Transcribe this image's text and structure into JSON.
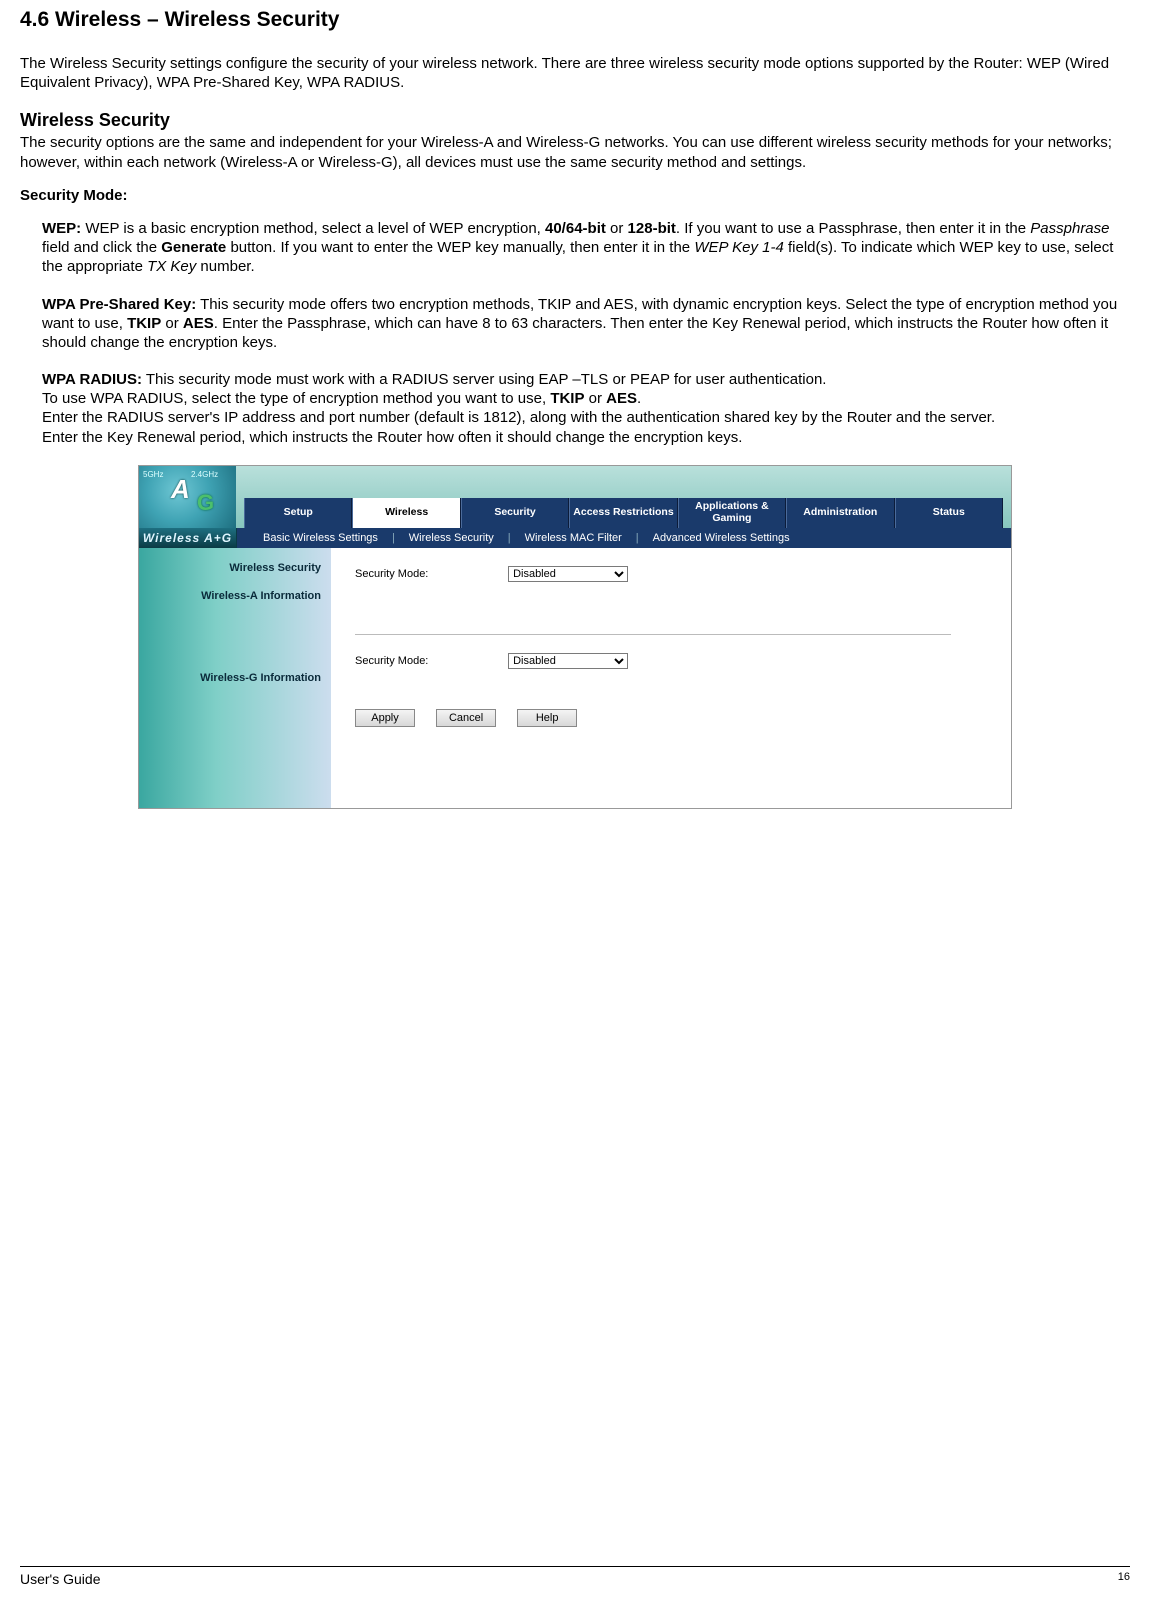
{
  "section_title": "4.6 Wireless – Wireless Security",
  "intro": "The Wireless Security settings configure the security of your wireless network. There are three wireless security mode options supported by the Router: WEP (Wired Equivalent Privacy), WPA Pre-Shared Key, WPA RADIUS.",
  "h_wireless_security": "Wireless Security",
  "ws_desc": "The security options are the same and independent for your Wireless-A and Wireless-G networks. You can use different wireless security methods for your networks; however, within each network (Wireless-A or Wireless-G), all devices must use the same security method and settings.",
  "h_security_mode": "Security Mode:",
  "wep_label": "WEP:",
  "wep_text_1": " WEP is a basic encryption method, select a level of WEP encryption, ",
  "wep_bold1": "40/64-bit",
  "wep_or": " or ",
  "wep_bold2": "128-bit",
  "wep_text_2": ". If you want to use a Passphrase, then enter it in the ",
  "wep_italic1": "Passphrase",
  "wep_text_3": " field and click the ",
  "wep_bold3": "Generate",
  "wep_text_4": " button. If you want to enter the WEP key manually, then enter it in the ",
  "wep_italic2": "WEP Key 1-4",
  "wep_text_5": " field(s). To indicate which WEP key to use, select the appropriate ",
  "wep_italic3": "TX Key",
  "wep_text_6": " number.",
  "wpa_psk_label": "WPA Pre-Shared Key:",
  "wpa_psk_text_1": " This security mode offers two encryption methods, TKIP and AES, with dynamic encryption keys. Select the type of encryption method you want to use, ",
  "wpa_psk_bold1": "TKIP",
  "wpa_psk_or": " or ",
  "wpa_psk_bold2": "AES",
  "wpa_psk_text_2": ". Enter the Passphrase, which can have 8 to 63 characters. Then enter the Key Renewal period, which instructs the Router how often it should change the encryption keys.",
  "wpa_rad_label": "WPA RADIUS:",
  "wpa_rad_text_1": " This security mode must work with a RADIUS server using EAP –TLS or PEAP for user authentication.",
  "wpa_rad_text_2a": "To use WPA RADIUS, select the type of encryption method you want to use, ",
  "wpa_rad_bold1": "TKIP",
  "wpa_rad_or": " or ",
  "wpa_rad_bold2": "AES",
  "wpa_rad_text_2b": ".",
  "wpa_rad_text_3": "Enter the RADIUS server's IP address and port number (default is 1812), along with the authentication shared key by the Router and the server.",
  "wpa_rad_text_4": "Enter the Key Renewal period, which instructs the Router how often it should change the encryption keys.",
  "router": {
    "logo_5": "5GHz",
    "logo_24": "2.4GHz",
    "logo_a": "A",
    "logo_g": "G",
    "brand": "Wireless A+G",
    "tabs": [
      "Setup",
      "Wireless",
      "Security",
      "Access Restrictions",
      "Applications & Gaming",
      "Administration",
      "Status"
    ],
    "subtabs": [
      "Basic Wireless Settings",
      "Wireless Security",
      "Wireless MAC Filter",
      "Advanced Wireless Settings"
    ],
    "side": [
      "Wireless Security",
      "Wireless-A Information",
      "Wireless-G Information"
    ],
    "label_secmode": "Security Mode:",
    "select_value": "Disabled",
    "btn_apply": "Apply",
    "btn_cancel": "Cancel",
    "btn_help": "Help"
  },
  "footer_left": "User's Guide",
  "footer_right": "16"
}
